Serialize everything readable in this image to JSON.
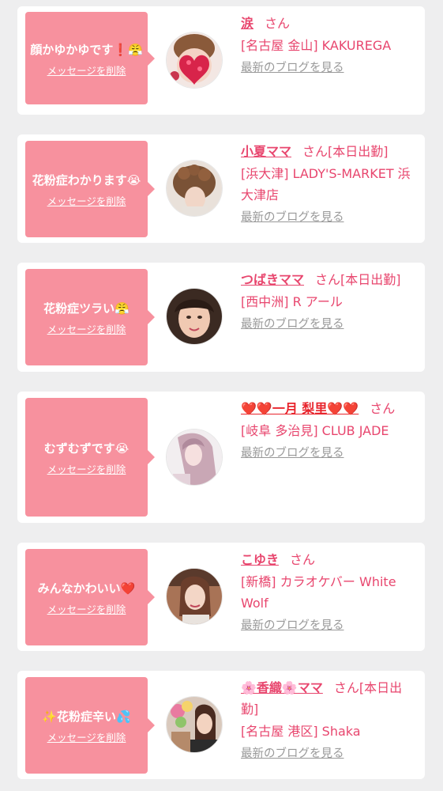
{
  "common": {
    "delete_label": "メッセージを削除",
    "san_label": "さん",
    "blog_label": "最新のブログを見る"
  },
  "items": [
    {
      "message": "顔かゆかゆです❗😤",
      "name": "涙",
      "status": "",
      "shop": "[名古屋 金山] KAKUREGA",
      "avatar": "heart-sticker-portrait"
    },
    {
      "message": "花粉症わかります😭",
      "name": "小夏ママ",
      "status": "[本日出勤]",
      "shop": "[浜大津] LADY'S-MARKET 浜大津店",
      "avatar": "curly-hair-portrait"
    },
    {
      "message": "花粉症ツラい😤",
      "name": "つばきママ",
      "status": "[本日出勤]",
      "shop": "[西中洲] R アール",
      "avatar": "smiling-woman-portrait"
    },
    {
      "message": "むずむずです😭",
      "name": "❤️❤️一月 梨里❤️❤️",
      "status": "",
      "shop": "[岐阜 多治見] CLUB JADE",
      "avatar": "long-hair-portrait"
    },
    {
      "message": "みんなかわいい❤️",
      "name": "こゆき",
      "status": "",
      "shop": "[新橋] カラオケバー White Wolf",
      "avatar": "woman-indoors-portrait"
    },
    {
      "message": "✨花粉症辛い💦",
      "name": "🌸香織🌸ママ",
      "status": "[本日出勤]",
      "shop": "[名古屋 港区] Shaka",
      "avatar": "woman-with-bouquet-portrait"
    }
  ],
  "colors": {
    "bubble": "#f7919e",
    "name": "#e8466e",
    "link_gray": "#999999",
    "background": "#eeeeef"
  }
}
